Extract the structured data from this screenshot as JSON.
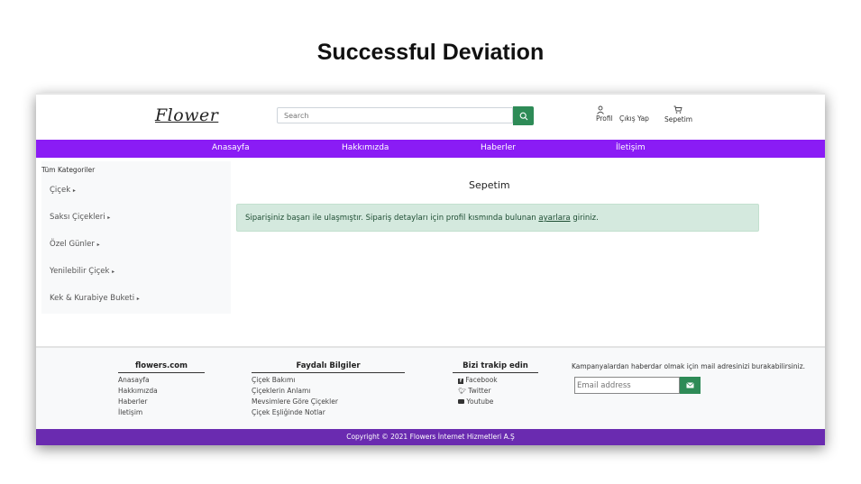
{
  "slide": {
    "title": "Successful Deviation"
  },
  "header": {
    "logo": "Flower",
    "search_placeholder": "Search",
    "links": {
      "profile": "Profil",
      "logout": "Çıkış Yap",
      "cart": "Sepetim"
    }
  },
  "nav": {
    "items": [
      "Anasayfa",
      "Hakkımızda",
      "Haberler",
      "İletişim"
    ]
  },
  "sidebar": {
    "heading": "Tüm Kategoriler",
    "items": [
      "Çiçek",
      "Saksı Çiçekleri",
      "Özel Günler",
      "Yenilebilir Çiçek",
      "Kek & Kurabiye Buketi"
    ]
  },
  "main": {
    "title": "Sepetim",
    "alert": {
      "before": "Siparişiniz başarı ile ulaşmıştır. Sipariş detayları için profil kısmında bulunan",
      "link": "ayarlara",
      "after": "giriniz."
    }
  },
  "footer": {
    "col1": {
      "title": "flowers.com",
      "links": [
        "Anasayfa",
        "Hakkımızda",
        "Haberler",
        "İletişim"
      ]
    },
    "col2": {
      "title": "Faydalı Bilgiler",
      "links": [
        "Çiçek Bakımı",
        "Çiçeklerin Anlamı",
        "Mevsimlere Göre Çiçekler",
        "Çiçek Eşliğinde Notlar"
      ]
    },
    "col3": {
      "title": "Bizi trakip edin",
      "links": [
        "Facebook",
        "Twitter",
        "Youtube"
      ]
    },
    "newsletter": {
      "note": "Kampanyalardan haberdar olmak için mail adresinizi burakabilirsiniz.",
      "email_placeholder": "Email address"
    },
    "copyright": "Copyright © 2021 Flowers İnternet Hizmetleri A.Ş"
  },
  "colors": {
    "nav": "#8a1cf5",
    "footer_bar": "#6a2bb0",
    "button": "#2e8b57",
    "alert_bg": "#d4e9de"
  },
  "icons": [
    "search-icon",
    "user-icon",
    "cart-icon",
    "chevron-right-icon",
    "facebook-icon",
    "twitter-icon",
    "youtube-icon",
    "envelope-icon"
  ]
}
